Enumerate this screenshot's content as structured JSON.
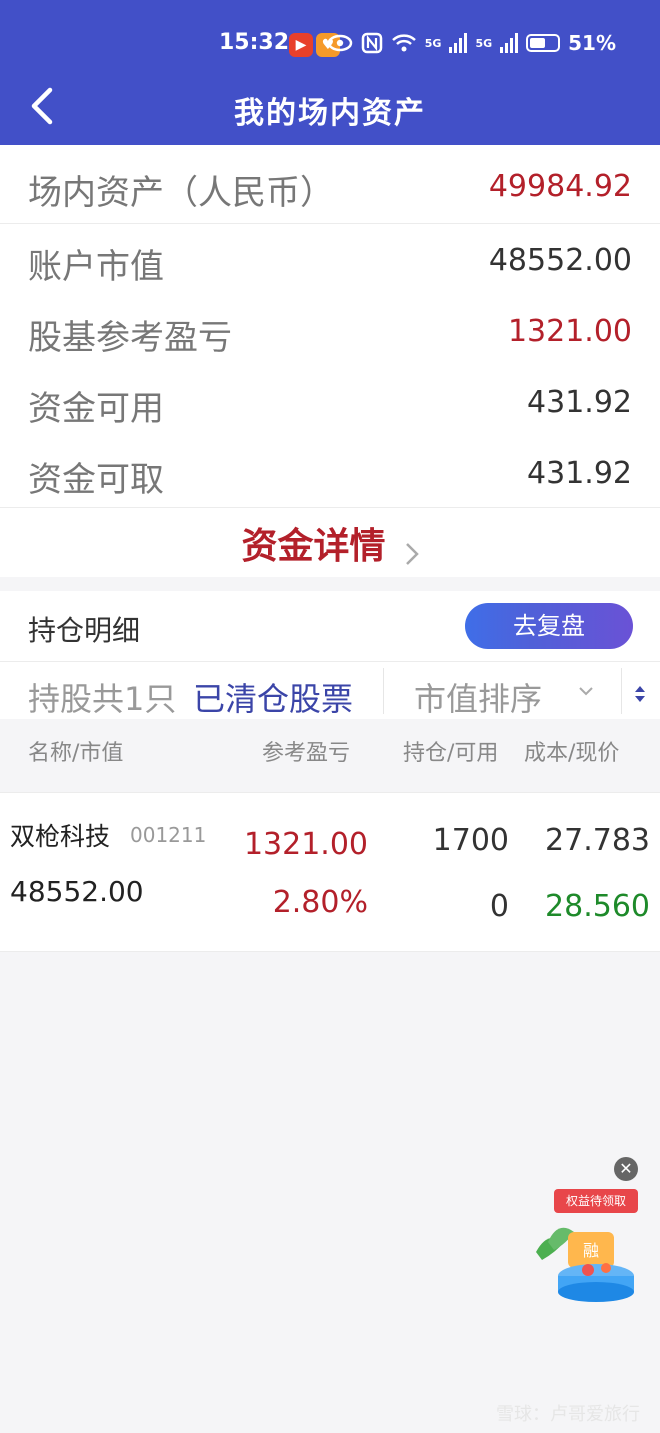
{
  "status_bar": {
    "time": "15:32",
    "network_1": "5G",
    "network_2": "5G",
    "battery": "51%"
  },
  "header": {
    "title": "我的场内资产"
  },
  "summary": {
    "rows": [
      {
        "label": "场内资产（人民币）",
        "value": "49984.92"
      },
      {
        "label": "账户市值",
        "value": "48552.00"
      },
      {
        "label": "股基参考盈亏",
        "value": "1321.00"
      },
      {
        "label": "资金可用",
        "value": "431.92"
      },
      {
        "label": "资金可取",
        "value": "431.92"
      }
    ],
    "detail_link": "资金详情"
  },
  "holdings": {
    "title": "持仓明细",
    "review_button": "去复盘",
    "count_text": "持股共1只",
    "cleared_link": "已清仓股票",
    "sort_label": "市值排序"
  },
  "columns": {
    "name_mv": "名称/市值",
    "ref_pl": "参考盈亏",
    "position": "持仓/可用",
    "cost_price": "成本/现价"
  },
  "stocks": [
    {
      "name": "双枪科技",
      "code": "001211",
      "market_value": "48552.00",
      "profit": "1321.00",
      "profit_pct": "2.80%",
      "position": "1700",
      "available": "0",
      "cost": "27.783",
      "price": "28.560"
    }
  ],
  "promo": {
    "tag": "权益待领取",
    "badge_char": "融"
  },
  "watermark": "雪球：卢哥爱旅行",
  "colors": {
    "header_bg": "#4250c8",
    "red": "#b3202a",
    "green": "#1e8a2a",
    "accent_blue": "#3b45a8"
  }
}
